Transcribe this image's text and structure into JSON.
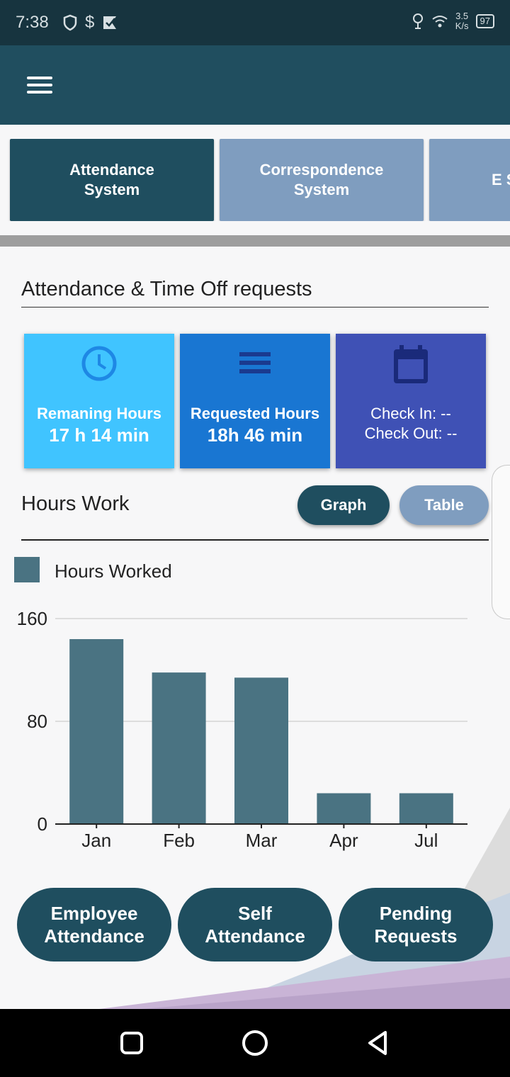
{
  "status_bar": {
    "time": "7:38",
    "left_icons": [
      "shield-icon",
      "dollar-icon",
      "check-flag-icon"
    ],
    "net_speed_value": "3.5",
    "net_speed_unit": "K/s",
    "battery": "97"
  },
  "app_bar": {
    "menu_icon": "hamburger-menu-icon"
  },
  "tabs": [
    {
      "label": "Attendance System",
      "active": true
    },
    {
      "label": "Correspondence System",
      "active": false
    },
    {
      "label": "E Sel",
      "active": false
    }
  ],
  "section": {
    "title": "Attendance & Time Off requests"
  },
  "cards": {
    "remaining": {
      "label": "Remaning Hours",
      "value": "17 h 14 min",
      "icon": "clock-icon",
      "color": "#40c4ff"
    },
    "requested": {
      "label": "Requested Hours",
      "value": "18h 46 min",
      "icon": "list-icon",
      "color": "#1976d2"
    },
    "check": {
      "check_in": "Check In: --",
      "check_out": "Check Out: --",
      "icon": "calendar-icon",
      "color": "#3f51b5"
    }
  },
  "hours_work": {
    "title": "Hours Work",
    "graph_label": "Graph",
    "table_label": "Table",
    "legend": "Hours Worked"
  },
  "chart_data": {
    "type": "bar",
    "categories": [
      "Jan",
      "Feb",
      "Mar",
      "Apr",
      "Jul"
    ],
    "series": [
      {
        "name": "Hours Worked",
        "values": [
          144,
          118,
          114,
          24,
          24
        ]
      }
    ],
    "ylim": [
      0,
      160
    ],
    "yticks": [
      0,
      80,
      160
    ],
    "grid": true,
    "legend_position": "top-left",
    "bar_color": "#4a7382"
  },
  "actions": [
    {
      "label": "Employee Attendance"
    },
    {
      "label": "Self Attendance"
    },
    {
      "label": "Pending Requests"
    }
  ],
  "nav_bar": {
    "icons": [
      "recents-square-icon",
      "home-circle-icon",
      "back-triangle-icon"
    ]
  }
}
